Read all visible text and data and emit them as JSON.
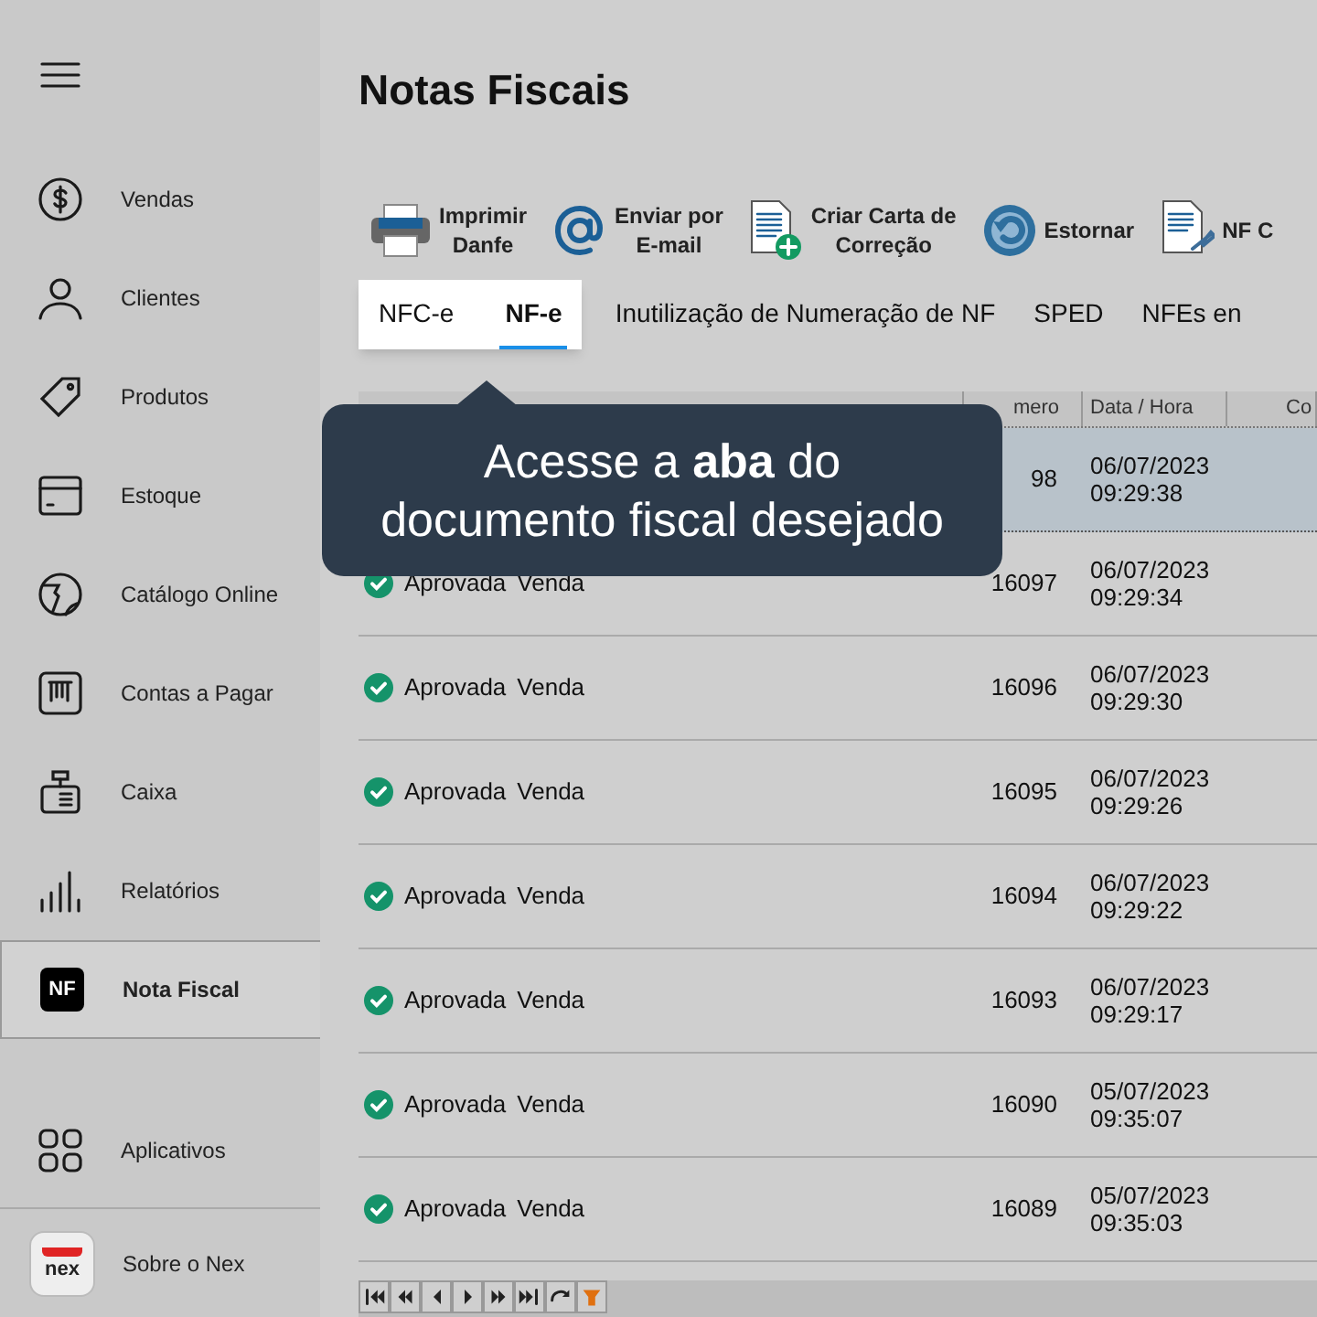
{
  "sidebar": {
    "items": [
      {
        "kind": "dollar",
        "label": "Vendas",
        "selected": false
      },
      {
        "kind": "person",
        "label": "Clientes",
        "selected": false
      },
      {
        "kind": "tag",
        "label": "Produtos",
        "selected": false
      },
      {
        "kind": "box",
        "label": "Estoque",
        "selected": false
      },
      {
        "kind": "globe",
        "label": "Catálogo Online",
        "selected": false
      },
      {
        "kind": "bill",
        "label": "Contas a Pagar",
        "selected": false
      },
      {
        "kind": "register",
        "label": "Caixa",
        "selected": false
      },
      {
        "kind": "bars",
        "label": "Relatórios",
        "selected": false
      },
      {
        "kind": "nf",
        "label": "Nota Fiscal",
        "selected": true,
        "badge": "NF"
      }
    ],
    "apps": {
      "label": "Aplicativos"
    },
    "about": {
      "label": "Sobre o Nex",
      "logo": "nex"
    }
  },
  "title": "Notas Fiscais",
  "toolbar": [
    {
      "kind": "printer",
      "label": "Imprimir\nDanfe"
    },
    {
      "kind": "at",
      "label": "Enviar por\nE-mail"
    },
    {
      "kind": "doc-plus",
      "label": "Criar Carta de\nCorreção"
    },
    {
      "kind": "undo",
      "label": "Estornar"
    },
    {
      "kind": "doc-pin",
      "label": "NF C"
    }
  ],
  "tabs": [
    {
      "label": "NFC-e",
      "selected": false
    },
    {
      "label": "NF-e",
      "selected": true
    },
    {
      "label": "Inutilização de Numeração de NF",
      "selected": false
    },
    {
      "label": "SPED",
      "selected": false
    },
    {
      "label": "NFEs en",
      "selected": false
    }
  ],
  "table": {
    "columns": [
      "mero",
      "Data / Hora",
      "Co"
    ],
    "rows": [
      {
        "number": "98",
        "date": "06/07/2023",
        "time": "09:29:38",
        "selected": true
      },
      {
        "status": "Aprovada",
        "type": "Venda",
        "number": "16097",
        "date": "06/07/2023",
        "time": "09:29:34",
        "selected": false
      },
      {
        "status": "Aprovada",
        "type": "Venda",
        "number": "16096",
        "date": "06/07/2023",
        "time": "09:29:30",
        "selected": false
      },
      {
        "status": "Aprovada",
        "type": "Venda",
        "number": "16095",
        "date": "06/07/2023",
        "time": "09:29:26",
        "selected": false
      },
      {
        "status": "Aprovada",
        "type": "Venda",
        "number": "16094",
        "date": "06/07/2023",
        "time": "09:29:22",
        "selected": false
      },
      {
        "status": "Aprovada",
        "type": "Venda",
        "number": "16093",
        "date": "06/07/2023",
        "time": "09:29:17",
        "selected": false
      },
      {
        "status": "Aprovada",
        "type": "Venda",
        "number": "16090",
        "date": "05/07/2023",
        "time": "09:35:07",
        "selected": false
      },
      {
        "status": "Aprovada",
        "type": "Venda",
        "number": "16089",
        "date": "05/07/2023",
        "time": "09:35:03",
        "selected": false
      }
    ]
  },
  "pager": [
    {
      "kind": "first"
    },
    {
      "kind": "prev-page"
    },
    {
      "kind": "prev"
    },
    {
      "kind": "next"
    },
    {
      "kind": "next-page"
    },
    {
      "kind": "last"
    },
    {
      "kind": "refresh"
    },
    {
      "kind": "filter"
    }
  ],
  "tooltip": {
    "text": "Acesse a **aba** do\ndocumento fiscal desejado"
  }
}
